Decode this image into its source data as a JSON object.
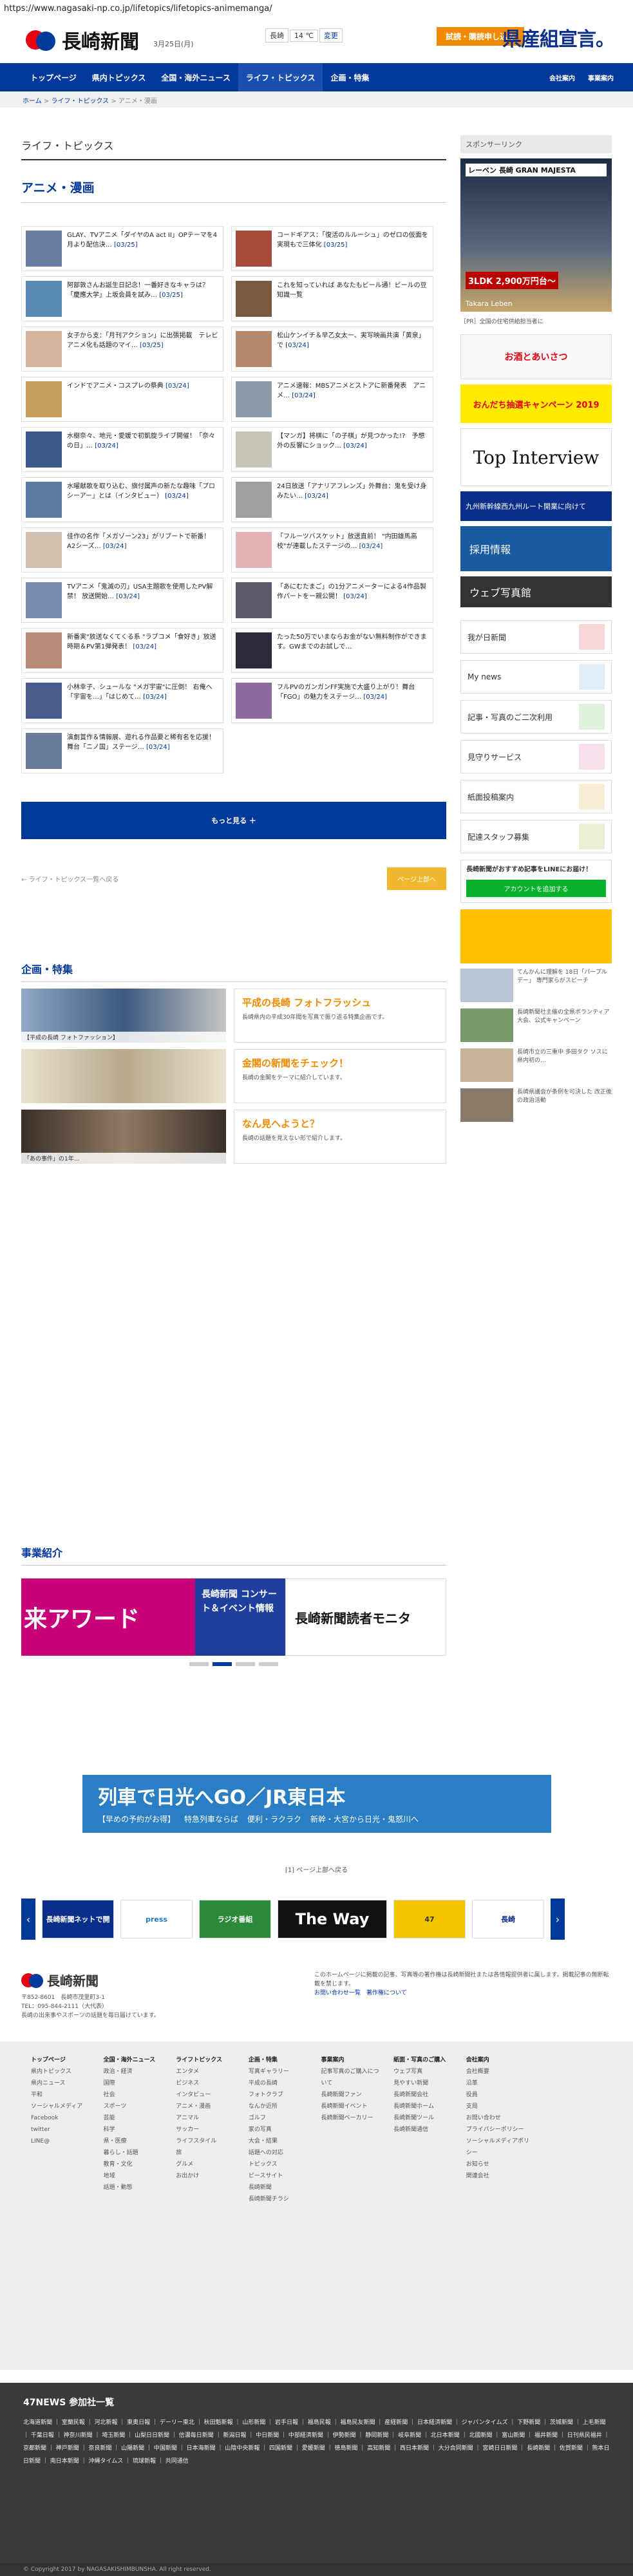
{
  "url": "https://www.nagasaki-np.co.jp/lifetopics/lifetopics-animemanga/",
  "header": {
    "logo": "長崎新聞",
    "date": "3月25日(月)",
    "weather_place": "長崎",
    "weather_temp": "14 ℃",
    "weather_btn": "変更",
    "subscribe": "試読・購読申し込み",
    "promo": "県産組宣言。"
  },
  "nav": {
    "items": [
      "トップページ",
      "県内トピックス",
      "全国・海外ニュース",
      "ライフ・トピックス",
      "企画・特集"
    ],
    "right": [
      "会社案内",
      "事業案内"
    ]
  },
  "breadcrumb": {
    "home": "ホーム",
    "lt": "ライフ・トピックス",
    "cur": "アニメ・漫画"
  },
  "main": {
    "section": "ライフ・トピックス",
    "category": "アニメ・漫画",
    "articles": [
      {
        "t": "GLAY、TVアニメ「ダイヤのA act II」OPテーマを4月より配信決…",
        "d": "[03/25]"
      },
      {
        "t": "コードギアス：「復活のルルーシュ」のゼロの仮面を実現もで三体化",
        "d": "[03/25]"
      },
      {
        "t": "阿部敦さんお誕生日記念！一番好きなキャラは？「慶應大学」上坂会員を試み…",
        "d": "[03/25]"
      },
      {
        "t": "これを知っていれば あなたもビール通！ビールの豆知識一覧",
        "d": ""
      },
      {
        "t": "女子から支：「月刊アクション」に出張掲載　テレビアニメ化も話題のマイ…",
        "d": "[03/25]"
      },
      {
        "t": "松山ケンイチ＆早乙女太一、実写映画共演「黄泉」で",
        "d": "[03/24]"
      },
      {
        "t": "インドでアニメ・コスプレの祭典",
        "d": "[03/24]"
      },
      {
        "t": "アニメ速報：MBSアニメとストアに新番発表　アニメ…",
        "d": "[03/24]"
      },
      {
        "t": "水樹奈々、地元・愛媛で初凱旋ライブ開催！「奈々の日」…",
        "d": "[03/24]"
      },
      {
        "t": "【マンガ】将棋に「の子棋」が見つかった!?　予想外の反響にショック…",
        "d": "[03/24]"
      },
      {
        "t": "水曜献歌を取り込む、旗付属声の新たな趣味「プロシーアー」とは（インタビュー）",
        "d": "[03/24]"
      },
      {
        "t": "24日放送「アナリアフレンズ」外舞台：鬼を受け身みたい…",
        "d": "[03/24]"
      },
      {
        "t": "佳作の名作「メガゾーン23」がリブートで新番！ A2シーズ…",
        "d": "[03/24]"
      },
      {
        "t": "「フルーツバスケット」放送直前！ \"内田雄馬高校\"が連載したステージの…",
        "d": "[03/24]"
      },
      {
        "t": "TVアニメ「鬼滅の刃」USA主題歌を使用したPV解禁！ 放送開始…",
        "d": "[03/24]"
      },
      {
        "t": "「あにむたまご」の1分アニメーターによる4作品製作パートをー親公開！",
        "d": "[03/24]"
      },
      {
        "t": "新番実\"放送なくてくる系 \"ラブコメ「食好き」放送時期＆PV第1弾発表！",
        "d": "[03/24]"
      },
      {
        "t": "たった50万でいまならお金がない無料制作ができます。GWまでのお試しで…",
        "d": ""
      },
      {
        "t": "小林幸子、シュールな \"メガ宇宙\"に圧倒！ 右俺へ「宇宙を…」「はじめて…",
        "d": "[03/24]"
      },
      {
        "t": "フルPVのガンガンFF実施で大盛り上がり！舞台「FGO」の魅力をステージ…",
        "d": "[03/24]"
      },
      {
        "t": "演劇賞作＆情報展、遊れる作品要と稀有名を応援！舞台「ニノ国」ステージ…",
        "d": "[03/24]"
      }
    ],
    "more": "もっと見る ＋",
    "back": "ライフ・トピックス一覧へ戻る",
    "pagetop": "ページ上部へ"
  },
  "feature": {
    "title": "企画・特集",
    "items": [
      {
        "cap": "【平成の長崎 フォトファッション】",
        "t": "平成の長崎\nフォトフラッシュ",
        "s": "長崎県内の平成30年間を写真で振り返る特集企画です。"
      },
      {
        "cap": "",
        "t": "金閣の新聞をチェック！",
        "s": "長崎の金閣をテーマに紹介しています。"
      },
      {
        "cap": "「あの事件」の1年…",
        "t": "なん見ヘようと？",
        "s": "長崎の話題を見えない形で紹介します。"
      }
    ]
  },
  "jigyo": {
    "title": "事業紹介",
    "p1": "来アワード",
    "p2": "長崎新聞 コンサート＆イベント情報",
    "p3": "長崎新聞読者モニタ"
  },
  "ad": {
    "title": "列車で日光へGO／JR東日本",
    "sub": [
      "【早めの予約がお得】",
      "特急列車ならば",
      "便利・ラクラク",
      "新幹・大宮から日光・鬼怒川へ"
    ]
  },
  "adpager": "[1] ページ上部へ戻る",
  "banners": [
    "長崎新聞ネットで開",
    "press",
    "ラジオ番組",
    "The Way",
    "47",
    "長崎"
  ],
  "footer": {
    "logo": "長崎新聞",
    "addr": "〒852-8601　長崎市茂里町3-1\nTEL：095-844-2111（大代表）",
    "copy": "長崎の出来事やスポーツの話題を毎日届けています。",
    "desc": "このホームページに掲載の記事、写真等の著作権は長崎新聞社または各情報提供者に属します。掲載記事の無断転載を禁じます。",
    "link1": "お問い合わせ一覧",
    "link2": "著作権について"
  },
  "sitemap": [
    [
      "トップページ",
      "県内トピックス",
      "県内ニュース",
      "平和",
      "ソーシャルメディア",
      "Facebook",
      "twitter",
      "LINE@"
    ],
    [
      "全国・海外ニュース",
      "政治・経済",
      "国際",
      "社会",
      "スポーツ",
      "芸能",
      "科学",
      "県・医療",
      "暮らし・話題",
      "教育・文化",
      "地域",
      "話題・動態"
    ],
    [
      "ライフトピックス",
      "エンタメ",
      "ビジネス",
      "インタビュー",
      "アニメ・漫画",
      "アニマル",
      "サッカー",
      "ライフスタイル",
      "旅",
      "グルメ",
      "お出かけ"
    ],
    [
      "企画・特集",
      "写真ギャラリー",
      "平成の長崎",
      "フォトクラブ",
      "なんか近所",
      "ゴルフ",
      "家の写真",
      "大会・結果",
      "話題への対応",
      "トピックス",
      "ピースサイト",
      "長崎新聞",
      "長崎新聞チラシ"
    ],
    [
      "事業案内",
      "記事写真のご購入について",
      "長崎新聞ファン",
      "長崎新聞イベント",
      "長崎新聞ベーカリー"
    ],
    [
      "紙面・写真のご購入",
      "ウェブ写真",
      "見やすい新聞",
      "長崎新聞会社",
      "長崎新聞ホーム",
      "長崎新聞ツール",
      "長崎新聞通信"
    ],
    [
      "会社案内",
      "会社概要",
      "沿革",
      "役員",
      "支局",
      "お問い合わせ",
      "プライバシーポリシー",
      "ソーシャルメディアポリシー",
      "お知らせ",
      "関連会社"
    ],
    [
      ""
    ]
  ],
  "news47": {
    "title": "47NEWS 参加社一覧",
    "list": "北海道新聞 ｜ 室蘭民報 ｜ 河北新報 ｜ 東奥日報 ｜ デーリー東北 ｜ 秋田魁新報 ｜ 山形新聞 ｜ 岩手日報 ｜ 福島民報 ｜ 福島民友新聞 ｜ 産経新聞 ｜ 日本経済新聞 ｜ ジャパンタイムズ ｜ 下野新聞 ｜ 茨城新聞 ｜ 上毛新聞 ｜ 千葉日報 ｜ 神奈川新聞 ｜ 埼玉新聞 ｜ 山梨日日新聞 ｜ 信濃毎日新聞 ｜ 新潟日報 ｜ 中日新聞 ｜ 中部経済新聞 ｜ 伊勢新聞 ｜ 静岡新聞 ｜ 岐阜新聞 ｜ 北日本新聞 ｜ 北國新聞 ｜ 富山新聞 ｜ 福井新聞 ｜ 日刊県民福井 ｜ 京都新聞 ｜ 神戸新聞 ｜ 奈良新聞 ｜ 山陽新聞 ｜ 中国新聞 ｜ 日本海新聞 ｜ 山陰中央新報 ｜ 四国新聞 ｜ 愛媛新聞 ｜ 徳島新聞 ｜ 高知新聞 ｜ 西日本新聞 ｜ 大分合同新聞 ｜ 宮崎日日新聞 ｜ 長崎新聞 ｜ 佐賀新聞 ｜ 熊本日日新聞 ｜ 南日本新聞 ｜ 沖縄タイムス ｜ 琉球新報 ｜ 共同通信"
  },
  "copyright": "© Copyright 2017 by NAGASAKISHIMBUNSHA. All right reserved.",
  "side": {
    "sponsor": "スポンサーリンク",
    "ad1": "レーベン 長崎 GRAN MAJESTA",
    "ad1b": "3LDK 2,900万円台〜",
    "ad1c": "Takara Leben",
    "ad1t": "［PR］全国の住宅供給担当者に",
    "ad2": "お酒とあいさつ",
    "ad3": "おんだち抽選キャンペーン 2019",
    "ad4": "Top Interview",
    "ad5": "九州新幹線西九州ルート開業に向けて",
    "job": "採用情報",
    "web": "ウェブ写真館",
    "links": [
      "我が日新聞",
      "My news",
      "記事・写真のご二次利用",
      "見守りサービス",
      "紙面投稿案内",
      "配達スタッフ募集"
    ],
    "line_t": "長崎新聞がおすすめ記事をLINEにお届け！",
    "line_g": "アカウントを追加する",
    "bottom": [
      {
        "x": "てんかんに理解を 18日「パープルデー」 専門家らがスピーチ"
      },
      {
        "x": "長崎新聞社主催の全県ボランティア大会、公式キャンペーン"
      },
      {
        "x": "長崎市立の三重中 多田タク ソスに県内初の…"
      },
      {
        "x": "長崎県議会が条例を可決した 改正後の政治活動"
      }
    ]
  }
}
